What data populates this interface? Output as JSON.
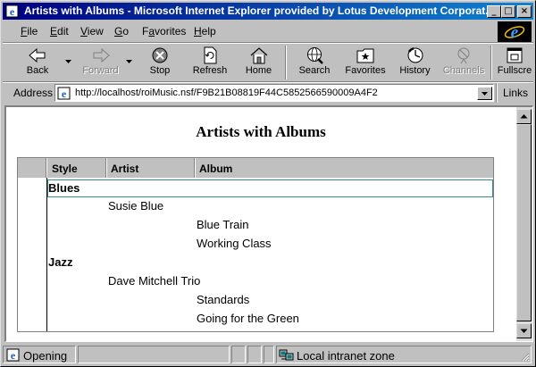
{
  "window": {
    "title": "Artists with Albums - Microsoft Internet Explorer provided by Lotus Development Corporat...",
    "controls": {
      "minimize": "_",
      "maximize": "□",
      "close": "×"
    }
  },
  "menu": [
    {
      "accel": "F",
      "rest": "ile"
    },
    {
      "accel": "E",
      "rest": "dit"
    },
    {
      "accel": "V",
      "rest": "iew"
    },
    {
      "accel": "G",
      "rest": "o"
    },
    {
      "pre": "F",
      "accel": "a",
      "rest": "vorites"
    },
    {
      "accel": "H",
      "rest": "elp"
    }
  ],
  "toolbar": {
    "back": "Back",
    "forward": "Forward",
    "stop": "Stop",
    "refresh": "Refresh",
    "home": "Home",
    "search": "Search",
    "favorites": "Favorites",
    "history": "History",
    "channels": "Channels",
    "fullscreen": "Fullscre"
  },
  "address": {
    "label": "Address",
    "url": "http://localhost/roiMusic.nsf/F9B21B08819F44C5852566590009A4F2",
    "links": "Links"
  },
  "page": {
    "title": "Artists with Albums"
  },
  "view": {
    "columns": [
      "Style",
      "Artist",
      "Album"
    ],
    "rows": [
      {
        "level": 0,
        "text": "Blues"
      },
      {
        "level": 1,
        "text": "Susie Blue"
      },
      {
        "level": 2,
        "text": "Blue Train"
      },
      {
        "level": 2,
        "text": "Working Class"
      },
      {
        "level": 0,
        "text": "Jazz"
      },
      {
        "level": 1,
        "text": "Dave Mitchell Trio"
      },
      {
        "level": 2,
        "text": "Standards"
      },
      {
        "level": 2,
        "text": "Going for the Green"
      }
    ]
  },
  "status": {
    "text": "Opening",
    "zone": "Local intranet zone"
  },
  "colors": {
    "titlebar_start": "#000080",
    "titlebar_end": "#1084d0",
    "selection_border": "#2f8f8f"
  }
}
